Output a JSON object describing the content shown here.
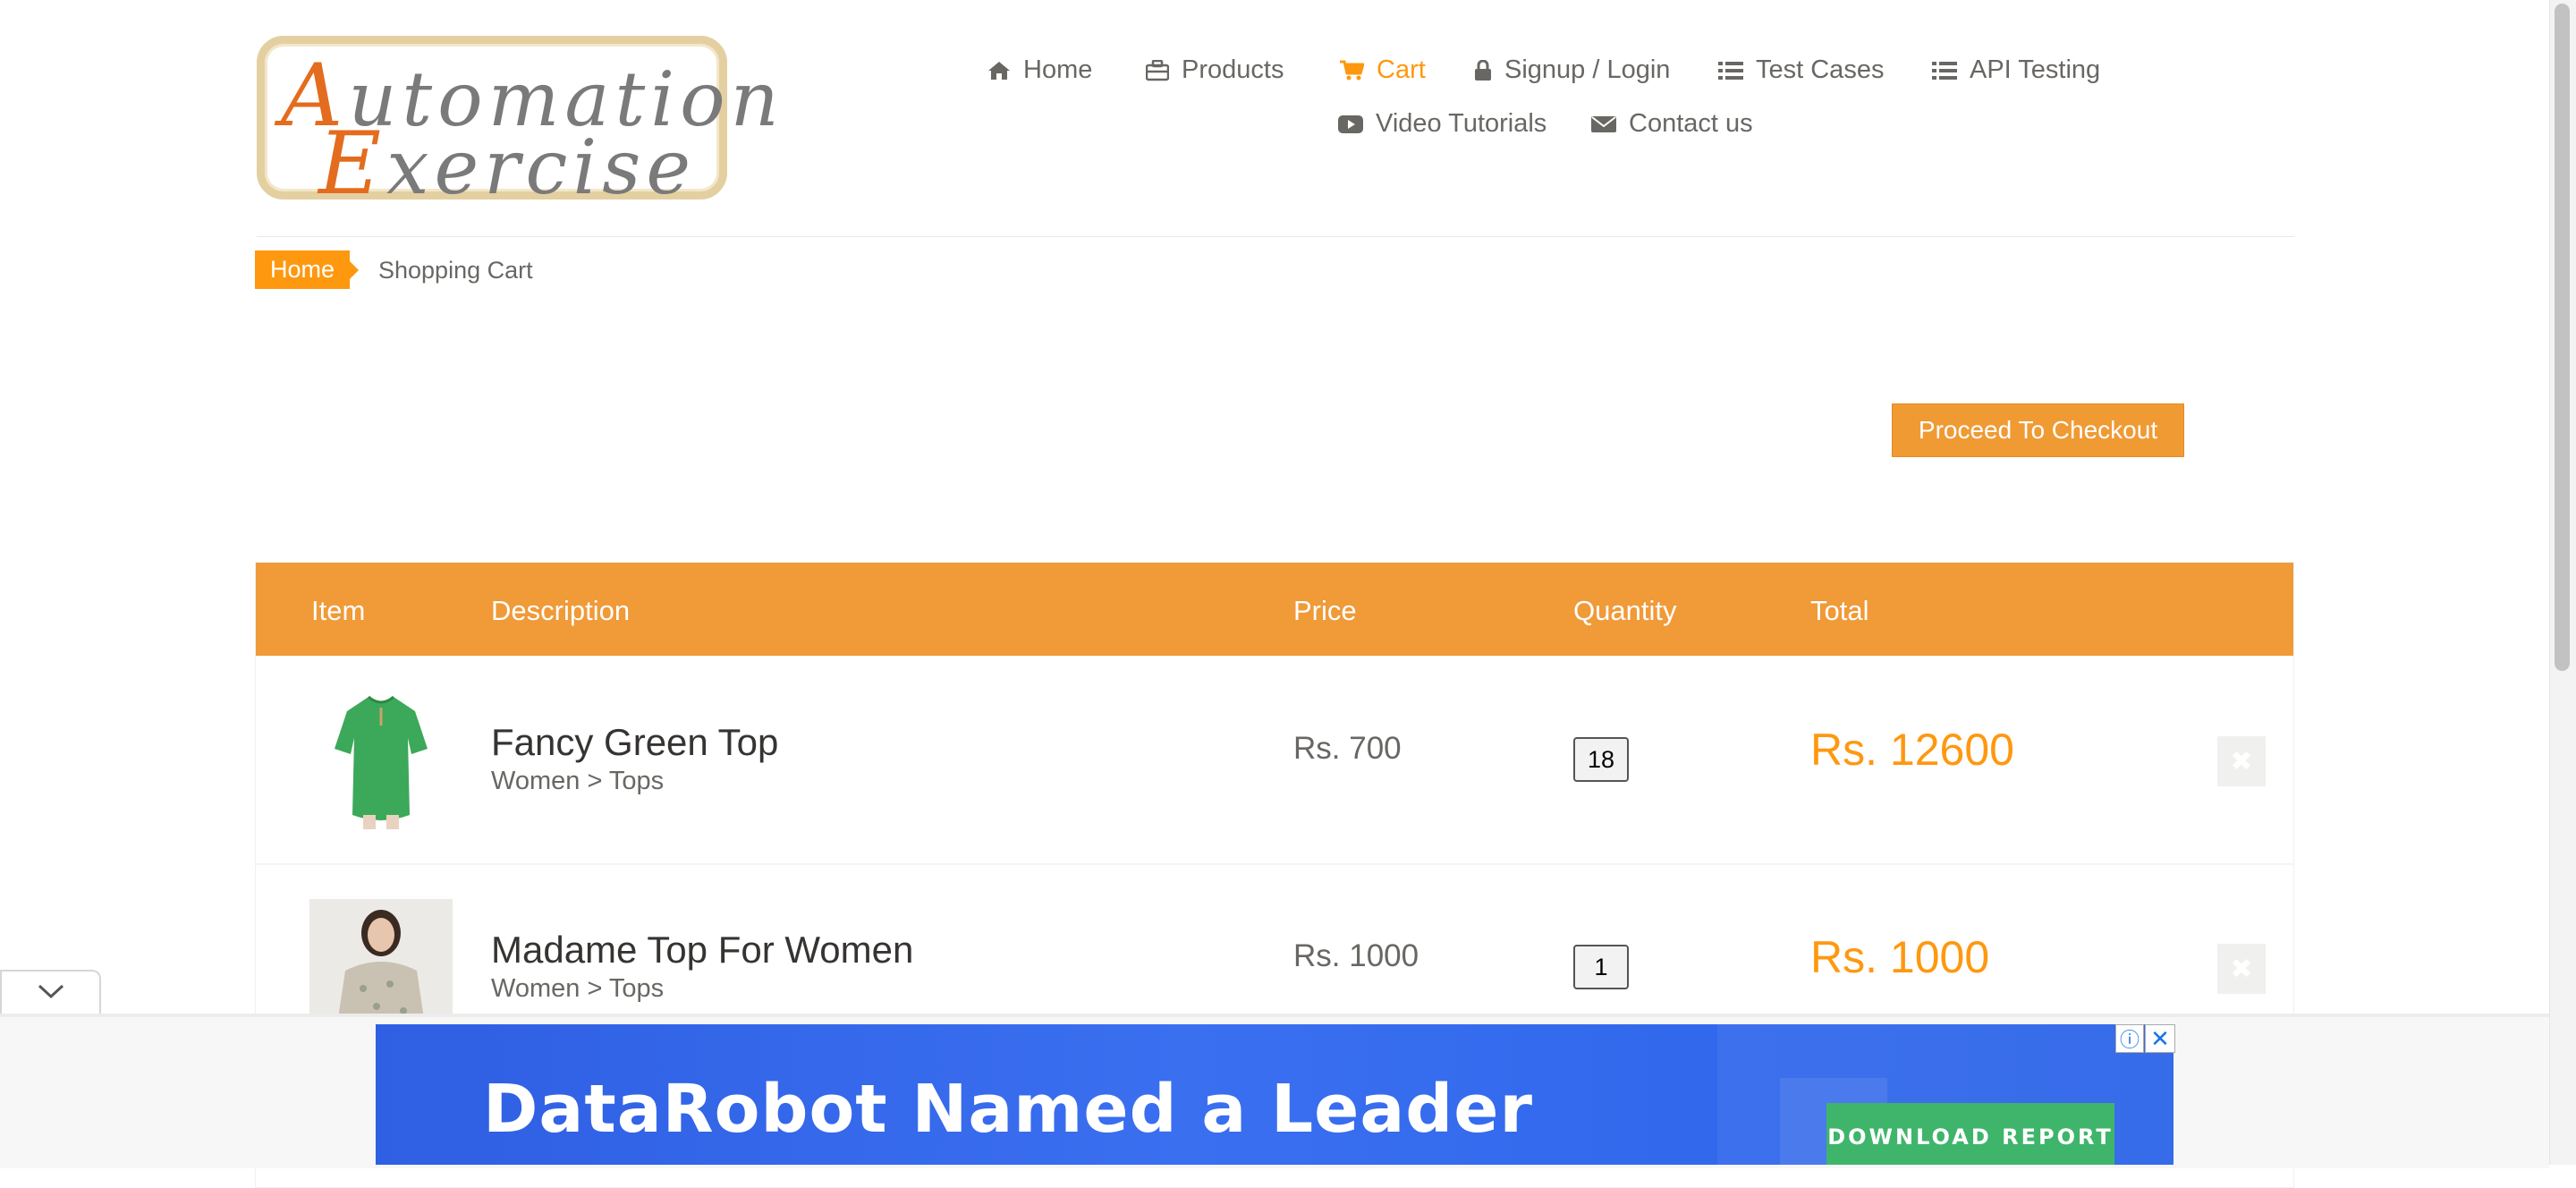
{
  "logo": {
    "line1": "utomation",
    "line1_cap": "A",
    "line2": "xercise",
    "line2_cap": "E"
  },
  "nav": {
    "home": "Home",
    "products": "Products",
    "cart": "Cart",
    "signup": "Signup / Login",
    "test_cases": "Test Cases",
    "api_testing": "API Testing",
    "video_tutorials": "Video Tutorials",
    "contact": "Contact us",
    "icons": [
      "home-icon",
      "briefcase-icon",
      "cart-icon",
      "lock-icon",
      "list-icon",
      "list-icon",
      "youtube-icon",
      "envelope-icon"
    ]
  },
  "breadcrumb": {
    "home": "Home",
    "current": "Shopping Cart"
  },
  "checkout_label": "Proceed To Checkout",
  "table": {
    "headers": {
      "item": "Item",
      "description": "Description",
      "price": "Price",
      "quantity": "Quantity",
      "total": "Total"
    },
    "rows": [
      {
        "name": "Fancy Green Top",
        "category": "Women > Tops",
        "price": "Rs. 700",
        "quantity": "18",
        "total": "Rs. 12600",
        "image": "green-top-image"
      },
      {
        "name": "Madame Top For Women",
        "category": "Women > Tops",
        "price": "Rs. 1000",
        "quantity": "1",
        "total": "Rs. 1000",
        "image": "floral-top-image"
      }
    ]
  },
  "ad": {
    "headline": "DataRobot Named a Leader",
    "button": "DOWNLOAD REPORT",
    "info": "ⓘ",
    "close": "✕"
  },
  "colors": {
    "accent": "#fe980f",
    "header_bar": "#f09a38",
    "ad_blue": "#2f5fe3",
    "ad_button": "#3fb56b"
  }
}
